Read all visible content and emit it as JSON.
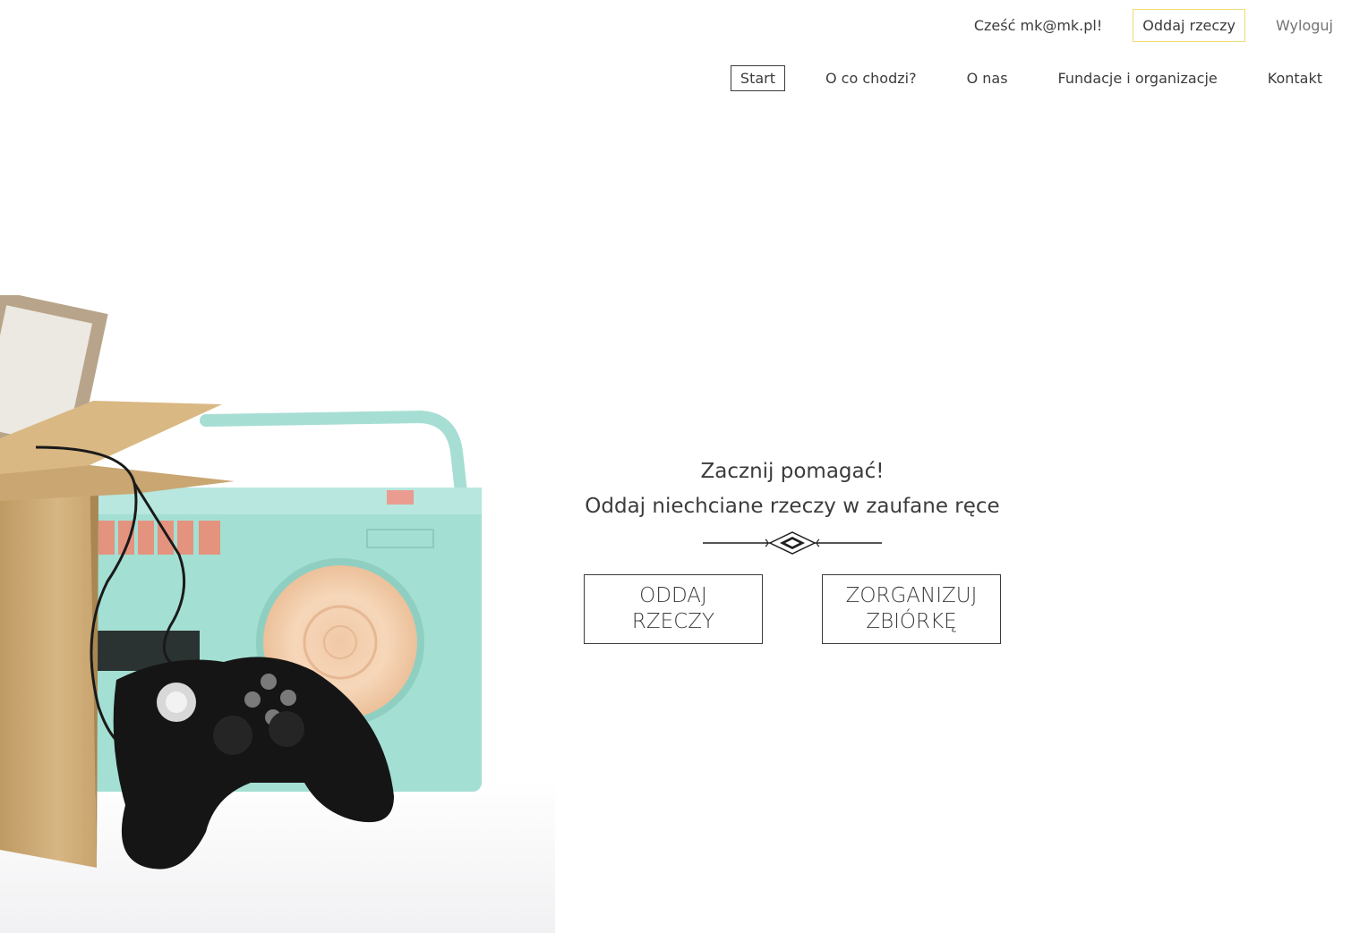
{
  "header": {
    "greeting": "Cześć mk@mk.pl!",
    "give_button": "Oddaj rzeczy",
    "logout": "Wyloguj",
    "nav": [
      {
        "label": "Start",
        "active": true
      },
      {
        "label": "O co chodzi?",
        "active": false
      },
      {
        "label": "O nas",
        "active": false
      },
      {
        "label": "Fundacje i organizacje",
        "active": false
      },
      {
        "label": "Kontakt",
        "active": false
      }
    ]
  },
  "hero": {
    "line1": "Zacznij pomagać!",
    "line2": "Oddaj niechciane rzeczy w zaufane ręce",
    "cta_give_line1": "ODDAJ",
    "cta_give_line2": "RZECZY",
    "cta_collect_line1": "ZORGANIZUJ",
    "cta_collect_line2": "ZBIÓRKĘ"
  },
  "colors": {
    "accent_border": "#f0dc74",
    "text": "#3c3c3c",
    "muted": "#737373"
  }
}
